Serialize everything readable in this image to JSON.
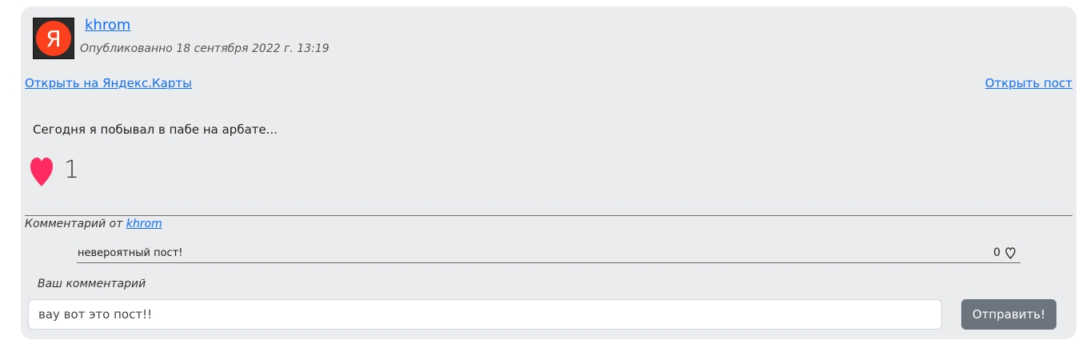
{
  "post": {
    "author": "khrom",
    "avatar_letter": "Я",
    "published": "Опубликованно 18 сентября 2022 г. 13:19",
    "open_map_link": "Открыть на Яндекс.Карты",
    "open_post_link": "Открыть пост",
    "text": "Сегодня я побывал в пабе на арбате...",
    "likes": "1"
  },
  "comments": {
    "meta_prefix": "Комментарий от ",
    "meta_author": "khrom",
    "items": [
      {
        "text": "невероятный пост!",
        "likes": "0"
      }
    ]
  },
  "form": {
    "label": "Ваш комментарий",
    "input_value": "вау вот это пост!!",
    "submit_label": "Отправить!"
  },
  "colors": {
    "link": "#0d6efd",
    "heart": "#ff2a5f",
    "button": "#6c757d",
    "card_bg": "#ebecee",
    "avatar_red": "#fc3f1d"
  },
  "icons": {
    "like": "heart-icon",
    "comment_like": "heart-outline-icon"
  }
}
